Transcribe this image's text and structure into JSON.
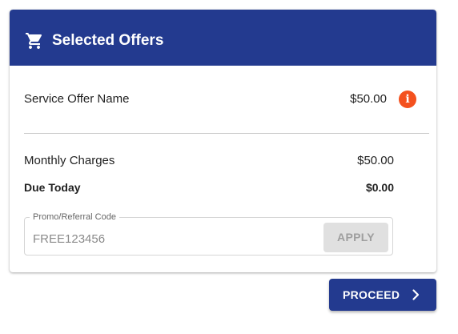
{
  "header": {
    "title": "Selected Offers",
    "icon": "shopping-cart-icon"
  },
  "offer": {
    "name": "Service Offer Name",
    "price": "$50.00",
    "info_icon": "info-icon"
  },
  "summary": {
    "monthly_label": "Monthly Charges",
    "monthly_value": "$50.00",
    "due_label": "Due Today",
    "due_value": "$0.00"
  },
  "promo": {
    "label": "Promo/Referral Code",
    "value": "FREE123456",
    "apply_label": "APPLY"
  },
  "actions": {
    "proceed_label": "PROCEED",
    "proceed_icon": "chevron-right-icon"
  },
  "colors": {
    "brand": "#233a8f",
    "info": "#f4511e",
    "disabled_bg": "#e0e0e0"
  }
}
